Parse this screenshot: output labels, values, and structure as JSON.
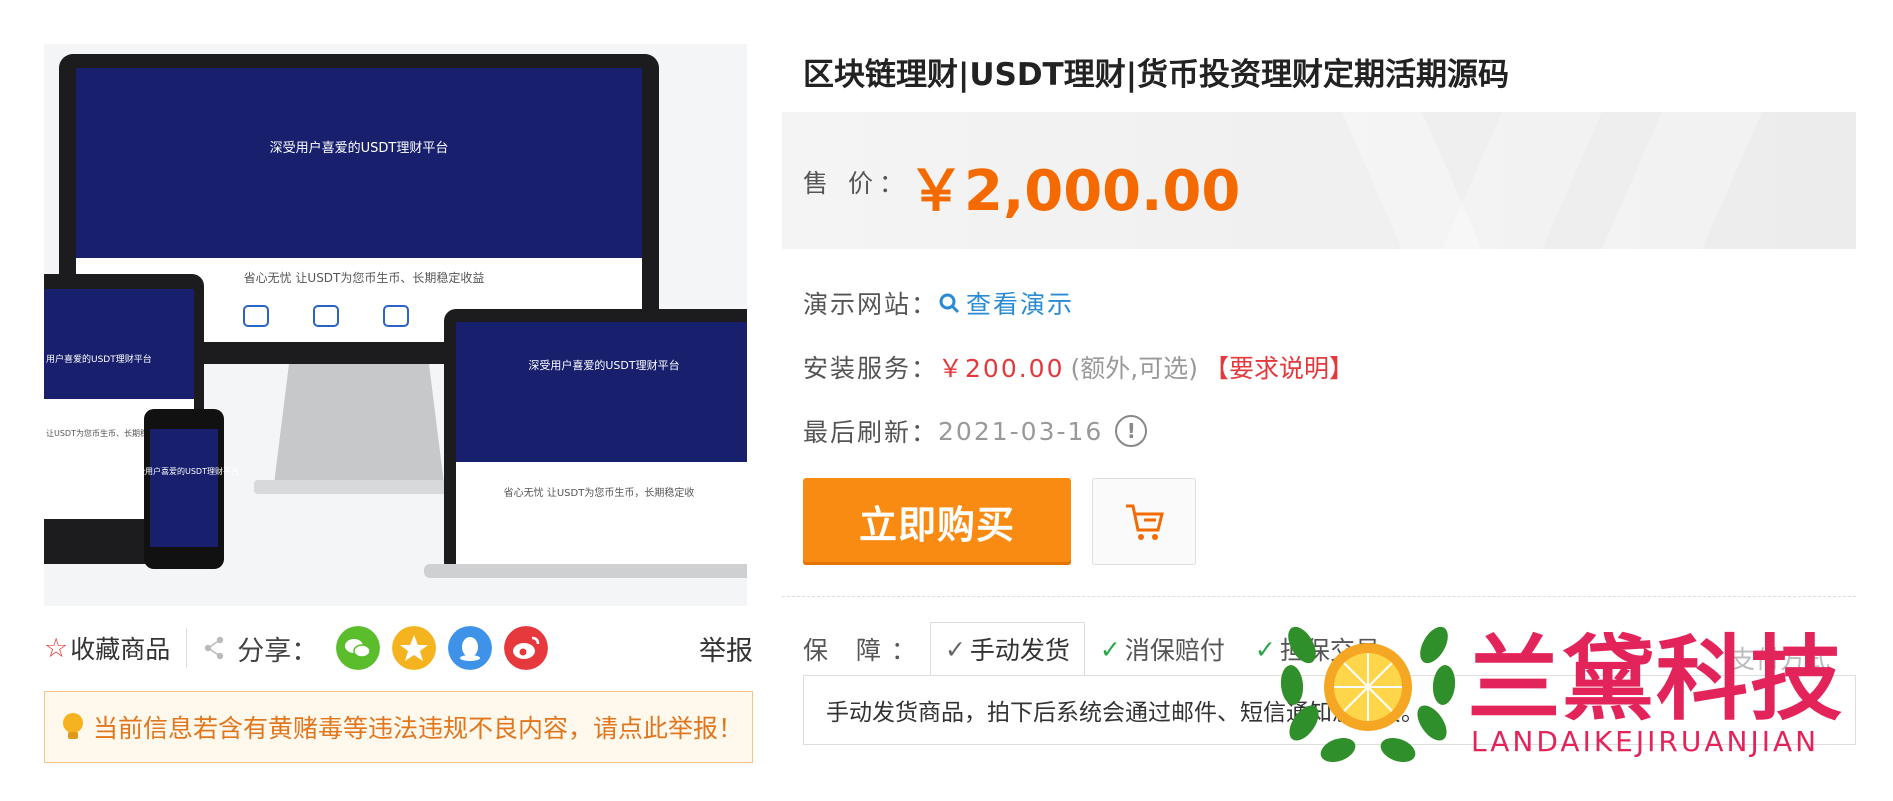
{
  "product": {
    "title": "区块链理财|USDT理财|货币投资理财定期活期源码",
    "price_label": "售 价：",
    "price": "￥2,000.00"
  },
  "gallery": {
    "hero_big": "深受用户喜爱的USDT理财平台",
    "hero_slogan": "省心无忧 让USDT为您币生币、长期稳定收益",
    "laptop_text": "深受用户喜爱的USDT理财平台",
    "laptop_slogan": "省心无忧 让USDT为您币生币，长期稳定收",
    "tablet_text": "用户喜爱的USDT理财平台",
    "tablet_slogan": "让USDT为您币生币、长期稳定收益",
    "phone_text": "深受用户喜爱的USDT理财平台"
  },
  "demo": {
    "label": "演示网站：",
    "link_text": "查看演示"
  },
  "install": {
    "label": "安装服务：",
    "price": "￥200.00",
    "note": "(额外,可选)",
    "link": "【要求说明】"
  },
  "refresh": {
    "label": "最后刷新：",
    "date": "2021-03-16",
    "info_glyph": "!"
  },
  "actions": {
    "buy_label": "立即购买"
  },
  "share": {
    "fav_label": "收藏商品",
    "share_label": "分享：",
    "report_label": "举报"
  },
  "notice": {
    "text": "当前信息若含有黄赌毒等违法违规不良内容，请点此举报！"
  },
  "guarantee": {
    "label": "保 障：",
    "tabs": [
      "手动发货",
      "消保赔付",
      "担保交易"
    ],
    "pay_label": "支付方式",
    "description": "手动发货商品，拍下后系统会通过邮件、短信通知您发货。"
  },
  "watermark": {
    "name": "兰黛科技",
    "sub": "LANDAIKEJIRUANJIAN"
  },
  "colors": {
    "price": "#f56a00",
    "buy": "#f98b12",
    "link": "#2a8bd4",
    "alert": "#e4393c",
    "watermark": "#e3245a"
  }
}
